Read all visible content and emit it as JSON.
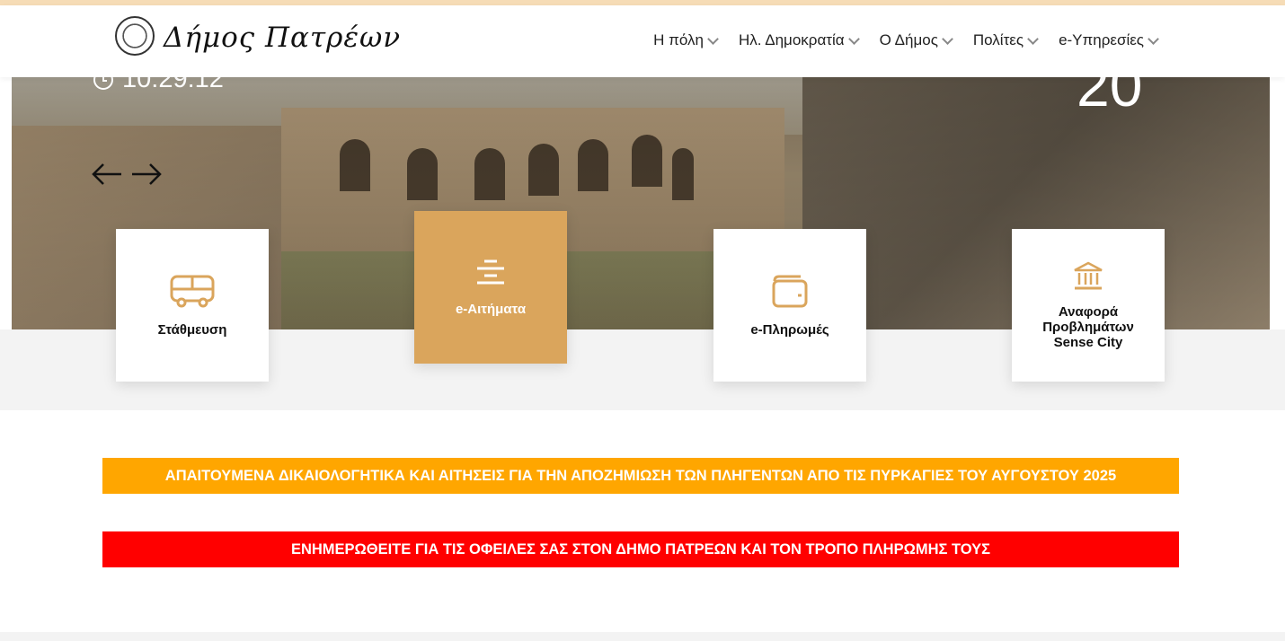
{
  "header": {
    "logo_text": "Δήμος Πατρέων",
    "nav": [
      {
        "label": "Η πόλη"
      },
      {
        "label": "Ηλ. Δημοκρατία"
      },
      {
        "label": "Ο Δήμος"
      },
      {
        "label": "Πολίτες"
      },
      {
        "label": "e-Υπηρεσίες"
      }
    ]
  },
  "hero": {
    "time": "10:29:12",
    "day": "20"
  },
  "services": [
    {
      "label": "Στάθμευση",
      "icon": "bus-icon"
    },
    {
      "label": "e-Αιτήματα",
      "icon": "align-center-icon"
    },
    {
      "label": "e-Πληρωμές",
      "icon": "wallet-icon"
    },
    {
      "label": "Αναφορά Προβλημάτων Sense City",
      "icon": "bank-icon"
    }
  ],
  "banners": {
    "orange": "ΑΠΑΙΤΟΥΜΕΝΑ ΔΙΚΑΙΟΛΟΓΗΤΙΚΑ ΚΑΙ ΑΙΤΗΣΕΙΣ ΓΙΑ ΤΗΝ ΑΠΟΖΗΜΙΩΣΗ ΤΩΝ ΠΛΗΓΕΝΤΩΝ ΑΠΟ ΤΙΣ ΠΥΡΚΑΓΙΕΣ ΤΟΥ ΑΥΓΟΥΣΤΟΥ 2025",
    "red": "ΕΝΗΜΕΡΩΘΕΙΤΕ ΓΙΑ ΤΙΣ ΟΦΕΙΛΕΣ ΣΑΣ ΣΤΟΝ ΔΗΜΟ ΠΑΤΡΕΩΝ ΚΑΙ ΤΟΝ ΤΡΟΠΟ ΠΛΗΡΩΜΗΣ ΤΟΥΣ"
  },
  "colors": {
    "accent": "#daa55c",
    "banner_orange": "#ffa600",
    "banner_red": "#ff0000"
  }
}
